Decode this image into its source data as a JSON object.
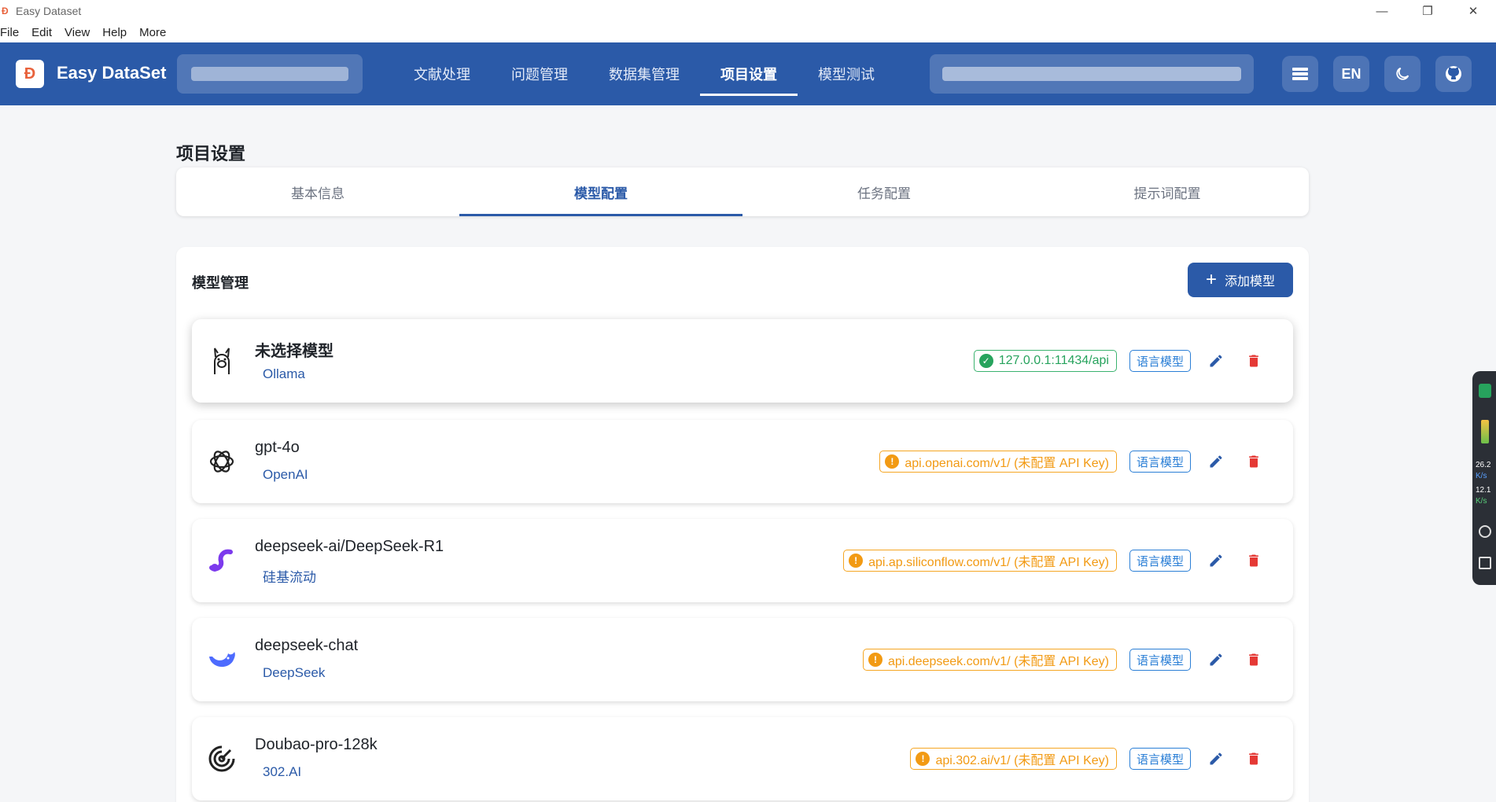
{
  "window": {
    "title": "Easy Dataset"
  },
  "menu": [
    "File",
    "Edit",
    "View",
    "Help",
    "More"
  ],
  "header": {
    "brand": "Easy DataSet",
    "nav": [
      "文献处理",
      "问题管理",
      "数据集管理",
      "项目设置",
      "模型测试"
    ],
    "active_nav": "项目设置",
    "lang_button": "EN"
  },
  "page": {
    "title": "项目设置",
    "tabs": [
      "基本信息",
      "模型配置",
      "任务配置",
      "提示词配置"
    ],
    "active_tab": "模型配置"
  },
  "model_management": {
    "title": "模型管理",
    "add_button": "添加模型",
    "models": [
      {
        "name": "未选择模型",
        "provider": "Ollama",
        "endpoint": "127.0.0.1:11434/api",
        "status": "ok",
        "type": "语言模型",
        "icon": "llama-icon"
      },
      {
        "name": "gpt-4o",
        "provider": "OpenAI",
        "endpoint": "api.openai.com/v1/ (未配置 API Key)",
        "status": "warn",
        "type": "语言模型",
        "icon": "openai-icon"
      },
      {
        "name": "deepseek-ai/DeepSeek-R1",
        "provider": "硅基流动",
        "endpoint": "api.ap.siliconflow.com/v1/ (未配置 API Key)",
        "status": "warn",
        "type": "语言模型",
        "icon": "siliconflow-icon"
      },
      {
        "name": "deepseek-chat",
        "provider": "DeepSeek",
        "endpoint": "api.deepseek.com/v1/ (未配置 API Key)",
        "status": "warn",
        "type": "语言模型",
        "icon": "deepseek-icon"
      },
      {
        "name": "Doubao-pro-128k",
        "provider": "302.AI",
        "endpoint": "api.302.ai/v1/ (未配置 API Key)",
        "status": "warn",
        "type": "语言模型",
        "icon": "302ai-icon"
      }
    ]
  },
  "side_widget": {
    "upload": "26.2",
    "download": "12.1",
    "unit": "K/s"
  },
  "colors": {
    "primary": "#2b5aa8",
    "ok": "#27a35d",
    "warn": "#f29a13",
    "danger": "#e53935",
    "tag": "#2b7fd6"
  }
}
